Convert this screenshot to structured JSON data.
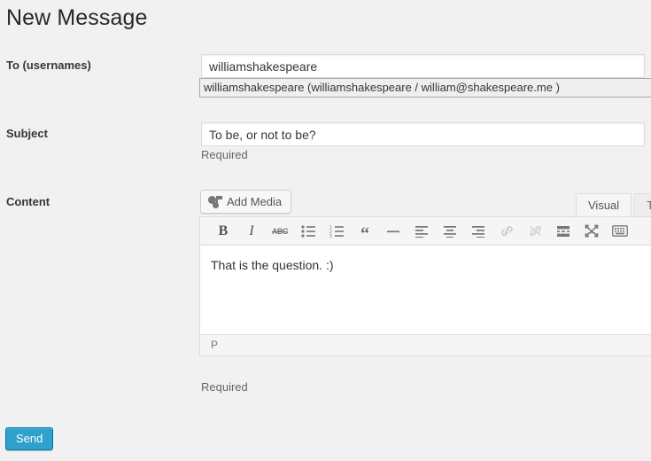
{
  "page": {
    "title": "New Message",
    "background_color": "#f1f1f1"
  },
  "fields": {
    "to": {
      "label": "To (usernames)",
      "value": "williamshakespeare",
      "placeholder": "",
      "autocomplete": {
        "visible": true,
        "items": [
          "williamshakespeare (williamshakespeare / william@shakespeare.me )"
        ]
      }
    },
    "subject": {
      "label": "Subject",
      "value": "To be, or not to be?",
      "placeholder": "",
      "required_note": "Required"
    },
    "content": {
      "label": "Content",
      "value": "That is the question. :)",
      "required_note": "Required"
    }
  },
  "editor": {
    "add_media_label": "Add Media",
    "add_media_icon": "media-camera-icon",
    "tabs": [
      {
        "label": "Visual",
        "active": true
      },
      {
        "label": "Text",
        "active": false
      }
    ],
    "toolbar": [
      {
        "name": "bold-icon",
        "title": "Bold",
        "glyph": "B",
        "disabled": false
      },
      {
        "name": "italic-icon",
        "title": "Italic",
        "glyph": "I",
        "disabled": false
      },
      {
        "name": "strikethrough-icon",
        "title": "Strikethrough",
        "glyph": "ABC",
        "disabled": false
      },
      {
        "name": "unordered-list-icon",
        "title": "Bulleted list",
        "glyph": "",
        "disabled": false
      },
      {
        "name": "ordered-list-icon",
        "title": "Numbered list",
        "glyph": "",
        "disabled": false
      },
      {
        "name": "blockquote-icon",
        "title": "Blockquote",
        "glyph": "“",
        "disabled": false
      },
      {
        "name": "horizontal-rule-icon",
        "title": "Horizontal line",
        "glyph": "",
        "disabled": false
      },
      {
        "name": "align-left-icon",
        "title": "Align left",
        "glyph": "",
        "disabled": false
      },
      {
        "name": "align-center-icon",
        "title": "Align center",
        "glyph": "",
        "disabled": false
      },
      {
        "name": "align-right-icon",
        "title": "Align right",
        "glyph": "",
        "disabled": false
      },
      {
        "name": "insert-link-icon",
        "title": "Insert/edit link",
        "glyph": "",
        "disabled": true
      },
      {
        "name": "remove-link-icon",
        "title": "Remove link",
        "glyph": "",
        "disabled": true
      },
      {
        "name": "read-more-icon",
        "title": "Insert Read More tag",
        "glyph": "",
        "disabled": false
      },
      {
        "name": "fullscreen-icon",
        "title": "Distraction-free writing mode",
        "glyph": "",
        "disabled": false
      },
      {
        "name": "toolbar-toggle-icon",
        "title": "Toolbar Toggle",
        "glyph": "",
        "disabled": false
      }
    ],
    "statusbar_path": "P"
  },
  "actions": {
    "send_label": "Send",
    "send_color": "#2ea2cc",
    "send_border_color": "#0074a2"
  }
}
